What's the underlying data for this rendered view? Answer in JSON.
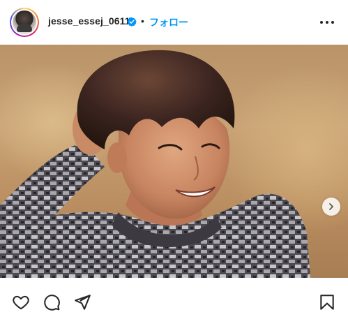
{
  "header": {
    "username": "jesse_essej_0611",
    "separator": "•",
    "follow_label": "フォロー"
  },
  "icons": {
    "verified": "verified-badge-icon",
    "more": "more-options-icon",
    "next": "chevron-right-icon",
    "like": "heart-icon",
    "comment": "comment-icon",
    "share": "paper-plane-icon",
    "save": "bookmark-icon"
  },
  "colors": {
    "follow": "#0095f6",
    "verified": "#0095f6",
    "text": "#262626"
  }
}
